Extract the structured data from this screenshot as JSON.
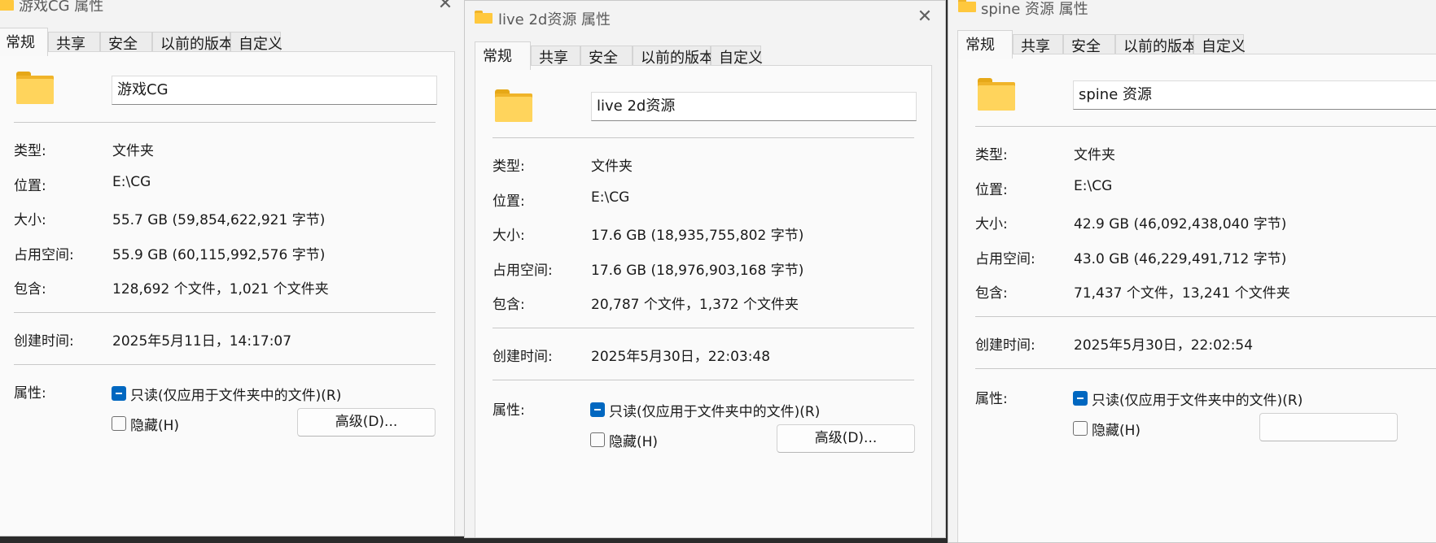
{
  "tabs": [
    "常规",
    "共享",
    "安全",
    "以前的版本",
    "自定义"
  ],
  "labels": {
    "type": "类型:",
    "location": "位置:",
    "size": "大小:",
    "size_on_disk": "占用空间:",
    "contains": "包含:",
    "created": "创建时间:",
    "attributes": "属性:",
    "readonly": "只读(仅应用于文件夹中的文件)(R)",
    "hidden": "隐藏(H)",
    "advanced": "高级(D)..."
  },
  "icons": {
    "folder": "folder-icon",
    "close": "close-icon",
    "checked": "checkbox-indeterminate-icon",
    "unchecked": "checkbox-unchecked-icon"
  },
  "colors": {
    "accent": "#0067c0",
    "folder": "#ffd45c"
  },
  "windows": [
    {
      "title": "游戏CG 属性",
      "name": "游戏CG",
      "type": "文件夹",
      "location": "E:\\CG",
      "size": "55.7 GB (59,854,622,921 字节)",
      "size_on_disk": "55.9 GB (60,115,992,576 字节)",
      "contains": "128,692 个文件，1,021 个文件夹",
      "created": "2025年5月11日，14:17:07",
      "readonly_state": "indeterminate",
      "hidden_state": "unchecked"
    },
    {
      "title": "live 2d资源 属性",
      "name": "live 2d资源",
      "type": "文件夹",
      "location": "E:\\CG",
      "size": "17.6 GB (18,935,755,802 字节)",
      "size_on_disk": "17.6 GB (18,976,903,168 字节)",
      "contains": "20,787 个文件，1,372 个文件夹",
      "created": "2025年5月30日，22:03:48",
      "readonly_state": "indeterminate",
      "hidden_state": "unchecked"
    },
    {
      "title": "spine 资源 属性",
      "name": "spine 资源",
      "type": "文件夹",
      "location": "E:\\CG",
      "size": "42.9 GB (46,092,438,040 字节)",
      "size_on_disk": "43.0 GB (46,229,491,712 字节)",
      "contains": "71,437 个文件，13,241 个文件夹",
      "created": "2025年5月30日，22:02:54",
      "readonly_state": "indeterminate",
      "hidden_state": "unchecked"
    }
  ]
}
